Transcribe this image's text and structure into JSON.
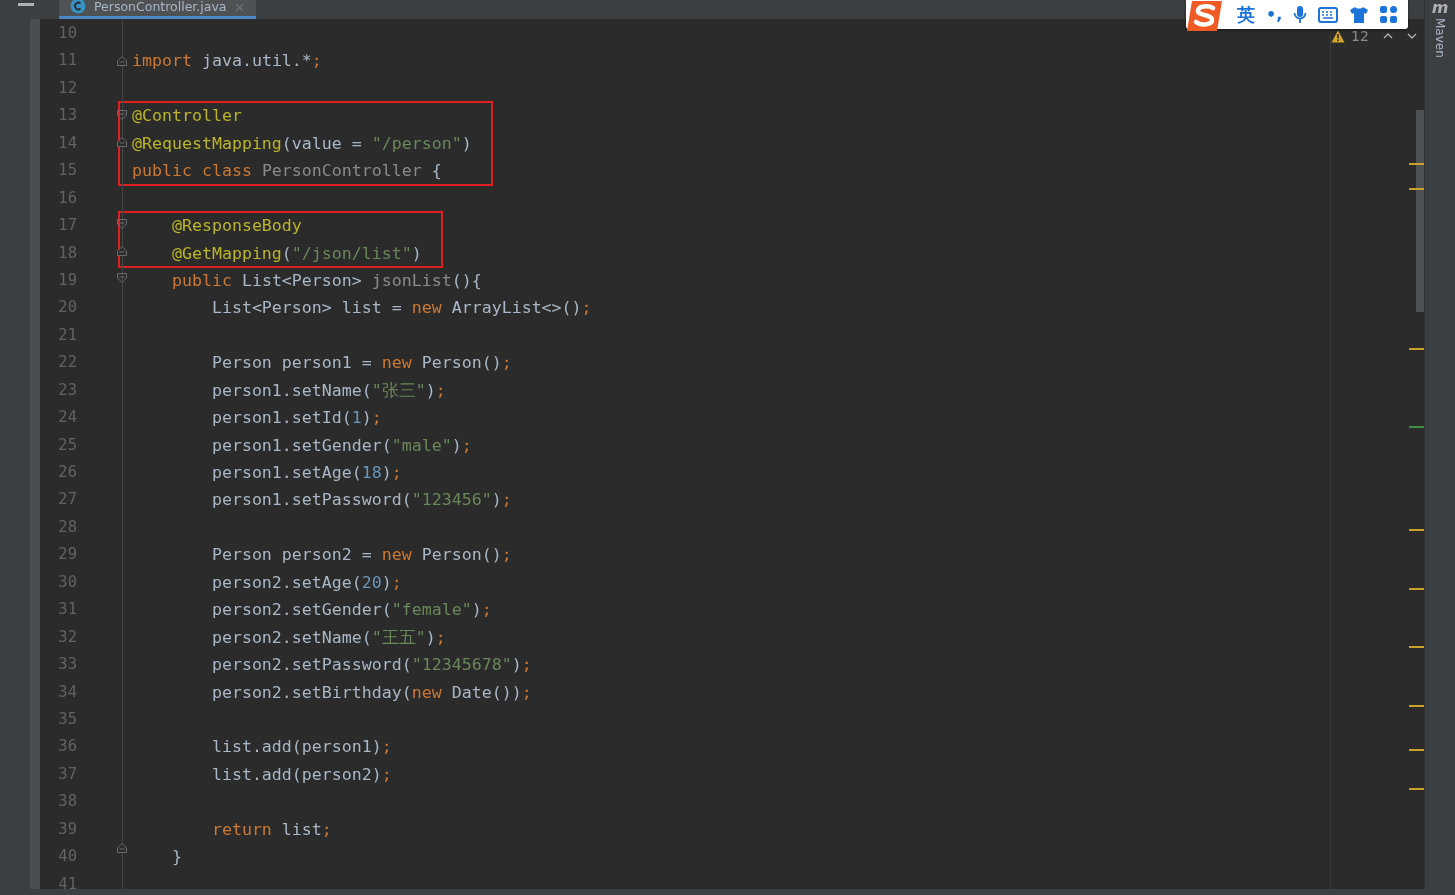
{
  "tab": {
    "title": "PersonController.java",
    "selected": true
  },
  "ime_toolbar": {
    "language": "英",
    "punctuation": "•,"
  },
  "inspection": {
    "warnings": "12"
  },
  "tool_window": {
    "logo": "m",
    "label": "Maven"
  },
  "blocks": [
    {
      "boxed": false,
      "lines": [
        {
          "number": "10",
          "fold_start": false,
          "fold_end": false
        },
        {
          "number": "11",
          "fold_start": false,
          "fold_end": true,
          "tokens": [
            {
              "kind": "kw",
              "text": "import"
            },
            {
              "kind": "plain",
              "text": " java.util.*"
            },
            {
              "kind": "semi",
              "text": ";"
            }
          ]
        },
        {
          "number": "12",
          "fold_start": false,
          "fold_end": false
        }
      ]
    },
    {
      "boxed": true,
      "lines": [
        {
          "number": "13",
          "fold_start": true,
          "fold_end": false,
          "tokens": [
            {
              "kind": "ann",
              "text": "@Controller"
            }
          ]
        },
        {
          "number": "14",
          "fold_start": false,
          "fold_end": true,
          "tokens": [
            {
              "kind": "ann",
              "text": "@RequestMapping"
            },
            {
              "kind": "plain",
              "text": "(value = "
            },
            {
              "kind": "str",
              "text": "\"/person\""
            },
            {
              "kind": "plain",
              "text": ")"
            }
          ]
        },
        {
          "number": "15",
          "fold_start": false,
          "fold_end": false,
          "tokens": [
            {
              "kind": "kw",
              "text": "public class "
            },
            {
              "kind": "dim",
              "text": "PersonController"
            },
            {
              "kind": "plain",
              "text": " {"
            }
          ]
        }
      ]
    },
    {
      "boxed": false,
      "lines": [
        {
          "number": "16",
          "fold_start": false,
          "fold_end": false
        }
      ]
    },
    {
      "boxed": true,
      "lines": [
        {
          "number": "17",
          "fold_start": true,
          "fold_end": false,
          "tokens": [
            {
              "kind": "ann",
              "text": "    @ResponseBody"
            }
          ]
        },
        {
          "number": "18",
          "fold_start": false,
          "fold_end": true,
          "tokens": [
            {
              "kind": "ann",
              "text": "    @GetMapping"
            },
            {
              "kind": "plain",
              "text": "("
            },
            {
              "kind": "str",
              "text": "\"/json/list\""
            },
            {
              "kind": "plain",
              "text": ")"
            }
          ]
        }
      ]
    },
    {
      "boxed": false,
      "lines": [
        {
          "number": "19",
          "fold_start": true,
          "fold_end": false,
          "tokens": [
            {
              "kind": "kw",
              "text": "    public "
            },
            {
              "kind": "plain",
              "text": "List<Person> "
            },
            {
              "kind": "dim",
              "text": "jsonList"
            },
            {
              "kind": "plain",
              "text": "(){"
            }
          ]
        },
        {
          "number": "20",
          "fold_start": false,
          "fold_end": false,
          "tokens": [
            {
              "kind": "plain",
              "text": "        List<Person> list = "
            },
            {
              "kind": "kw",
              "text": "new "
            },
            {
              "kind": "plain",
              "text": "ArrayList<>()"
            },
            {
              "kind": "semi",
              "text": ";"
            }
          ]
        },
        {
          "number": "21",
          "fold_start": false,
          "fold_end": false
        },
        {
          "number": "22",
          "fold_start": false,
          "fold_end": false,
          "tokens": [
            {
              "kind": "plain",
              "text": "        Person person1 = "
            },
            {
              "kind": "kw",
              "text": "new "
            },
            {
              "kind": "plain",
              "text": "Person()"
            },
            {
              "kind": "semi",
              "text": ";"
            }
          ]
        },
        {
          "number": "23",
          "fold_start": false,
          "fold_end": false,
          "tokens": [
            {
              "kind": "plain",
              "text": "        person1.setName("
            },
            {
              "kind": "str",
              "text": "\"张三\""
            },
            {
              "kind": "plain",
              "text": ")"
            },
            {
              "kind": "semi",
              "text": ";"
            }
          ]
        },
        {
          "number": "24",
          "fold_start": false,
          "fold_end": false,
          "tokens": [
            {
              "kind": "plain",
              "text": "        person1.setId("
            },
            {
              "kind": "num",
              "text": "1"
            },
            {
              "kind": "plain",
              "text": ")"
            },
            {
              "kind": "semi",
              "text": ";"
            }
          ]
        },
        {
          "number": "25",
          "fold_start": false,
          "fold_end": false,
          "tokens": [
            {
              "kind": "plain",
              "text": "        person1.setGender("
            },
            {
              "kind": "str",
              "text": "\"male\""
            },
            {
              "kind": "plain",
              "text": ")"
            },
            {
              "kind": "semi",
              "text": ";"
            }
          ]
        },
        {
          "number": "26",
          "fold_start": false,
          "fold_end": false,
          "tokens": [
            {
              "kind": "plain",
              "text": "        person1.setAge("
            },
            {
              "kind": "num",
              "text": "18"
            },
            {
              "kind": "plain",
              "text": ")"
            },
            {
              "kind": "semi",
              "text": ";"
            }
          ]
        },
        {
          "number": "27",
          "fold_start": false,
          "fold_end": false,
          "tokens": [
            {
              "kind": "plain",
              "text": "        person1.setPassword("
            },
            {
              "kind": "str",
              "text": "\"123456\""
            },
            {
              "kind": "plain",
              "text": ")"
            },
            {
              "kind": "semi",
              "text": ";"
            }
          ]
        },
        {
          "number": "28",
          "fold_start": false,
          "fold_end": false
        },
        {
          "number": "29",
          "fold_start": false,
          "fold_end": false,
          "tokens": [
            {
              "kind": "plain",
              "text": "        Person person2 = "
            },
            {
              "kind": "kw",
              "text": "new "
            },
            {
              "kind": "plain",
              "text": "Person()"
            },
            {
              "kind": "semi",
              "text": ";"
            }
          ]
        },
        {
          "number": "30",
          "fold_start": false,
          "fold_end": false,
          "tokens": [
            {
              "kind": "plain",
              "text": "        person2.setAge("
            },
            {
              "kind": "num",
              "text": "20"
            },
            {
              "kind": "plain",
              "text": ")"
            },
            {
              "kind": "semi",
              "text": ";"
            }
          ]
        },
        {
          "number": "31",
          "fold_start": false,
          "fold_end": false,
          "tokens": [
            {
              "kind": "plain",
              "text": "        person2.setGender("
            },
            {
              "kind": "str",
              "text": "\"female\""
            },
            {
              "kind": "plain",
              "text": ")"
            },
            {
              "kind": "semi",
              "text": ";"
            }
          ]
        },
        {
          "number": "32",
          "fold_start": false,
          "fold_end": false,
          "tokens": [
            {
              "kind": "plain",
              "text": "        person2.setName("
            },
            {
              "kind": "str",
              "text": "\"王五\""
            },
            {
              "kind": "plain",
              "text": ")"
            },
            {
              "kind": "semi",
              "text": ";"
            }
          ]
        },
        {
          "number": "33",
          "fold_start": false,
          "fold_end": false,
          "tokens": [
            {
              "kind": "plain",
              "text": "        person2.setPassword("
            },
            {
              "kind": "str",
              "text": "\"12345678\""
            },
            {
              "kind": "plain",
              "text": ")"
            },
            {
              "kind": "semi",
              "text": ";"
            }
          ]
        },
        {
          "number": "34",
          "fold_start": false,
          "fold_end": false,
          "tokens": [
            {
              "kind": "plain",
              "text": "        person2.setBirthday("
            },
            {
              "kind": "kw",
              "text": "new"
            },
            {
              "kind": "plain",
              "text": " Date())"
            },
            {
              "kind": "semi",
              "text": ";"
            }
          ]
        },
        {
          "number": "35",
          "fold_start": false,
          "fold_end": false
        },
        {
          "number": "36",
          "fold_start": false,
          "fold_end": false,
          "tokens": [
            {
              "kind": "plain",
              "text": "        list.add(person1)"
            },
            {
              "kind": "semi",
              "text": ";"
            }
          ]
        },
        {
          "number": "37",
          "fold_start": false,
          "fold_end": false,
          "tokens": [
            {
              "kind": "plain",
              "text": "        list.add(person2)"
            },
            {
              "kind": "semi",
              "text": ";"
            }
          ]
        },
        {
          "number": "38",
          "fold_start": false,
          "fold_end": false
        },
        {
          "number": "39",
          "fold_start": false,
          "fold_end": false,
          "tokens": [
            {
              "kind": "kw",
              "text": "        return "
            },
            {
              "kind": "plain",
              "text": "list"
            },
            {
              "kind": "semi",
              "text": ";"
            }
          ]
        },
        {
          "number": "40",
          "fold_start": false,
          "fold_end": true,
          "tokens": [
            {
              "kind": "plain",
              "text": "    }"
            }
          ]
        },
        {
          "number": "41",
          "fold_start": false,
          "fold_end": false
        }
      ]
    }
  ]
}
